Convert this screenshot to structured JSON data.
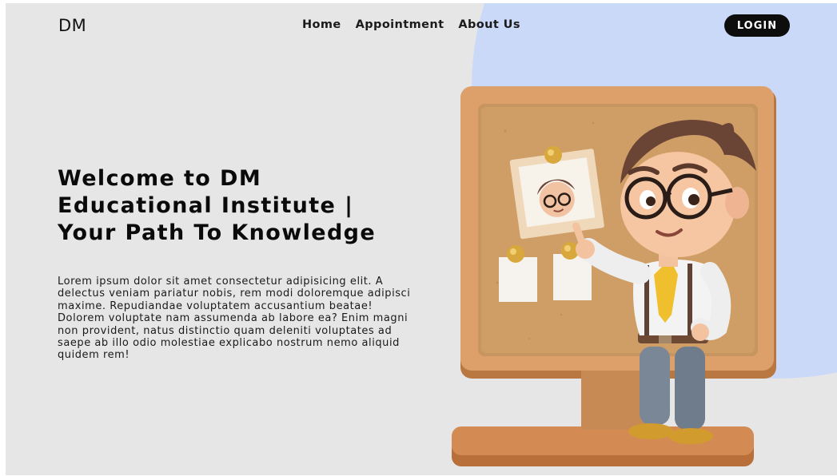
{
  "brand": {
    "logo": "DM"
  },
  "nav": {
    "items": [
      {
        "label": "Home"
      },
      {
        "label": "Appointment"
      },
      {
        "label": "About Us"
      }
    ]
  },
  "header": {
    "login_label": "LOGIN"
  },
  "hero": {
    "title_lines": [
      "Welcome to DM",
      "Educational Institute |",
      "Your Path To Knowledge"
    ],
    "body": "Lorem ipsum dolor sit amet consectetur adipisicing elit. A delectus veniam pariatur nobis, rem modi doloremque adipisci maxime. Repudiandae voluptatem accusantium beatae! Dolorem voluptate nam assumenda ab labore ea? Enim magni non provident, natus distinctio quam deleniti voluptates ad saepe ab illo odio molestiae explicabo nostrum nemo aliquid quidem rem!"
  },
  "colors": {
    "page_bg": "#e6e6e6",
    "accent_blob": "#cad9f8",
    "login_bg": "#0d0d0d",
    "board_frame": "#d79a63",
    "cork": "#c99a64"
  },
  "illustration": {
    "name": "teacher-at-corkboard-illustration"
  }
}
